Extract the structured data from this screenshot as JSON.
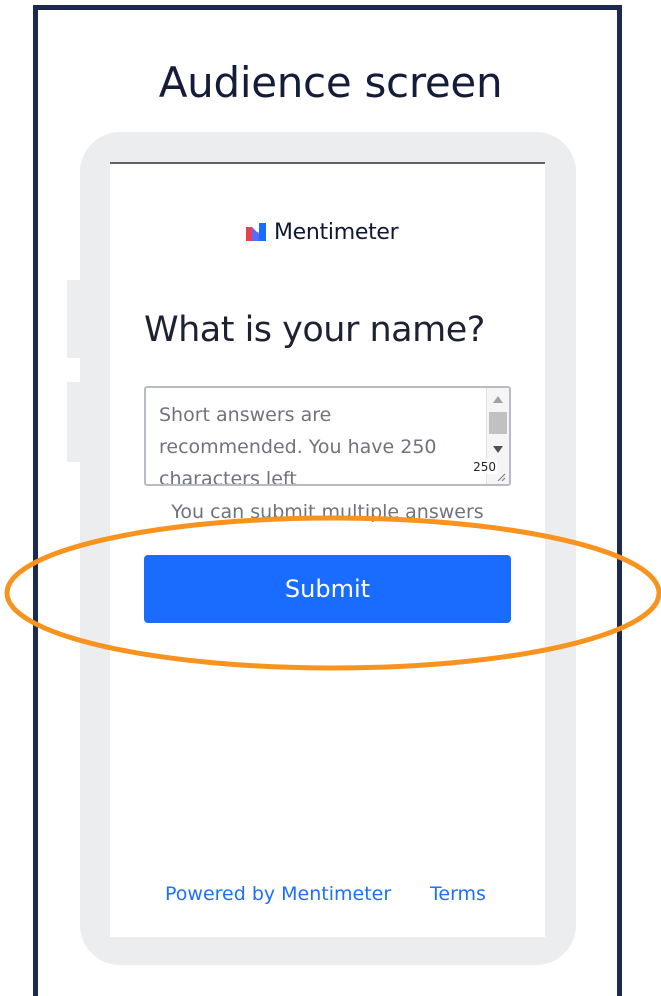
{
  "heading": "Audience screen",
  "logo": {
    "text": "Mentimeter",
    "icon": "mentimeter-logo-icon"
  },
  "question": "What is your name?",
  "answer": {
    "placeholder": "Short answers are recommended. You have 250 characters left",
    "value": "",
    "char_count": "250"
  },
  "hint": "You can submit multiple answers",
  "submit_label": "Submit",
  "footer": {
    "powered_by": "Powered by Mentimeter",
    "terms": "Terms"
  },
  "colors": {
    "frame": "#1b2a4e",
    "accent": "#196cff",
    "highlight": "#f7931e",
    "link": "#1f6fff"
  }
}
